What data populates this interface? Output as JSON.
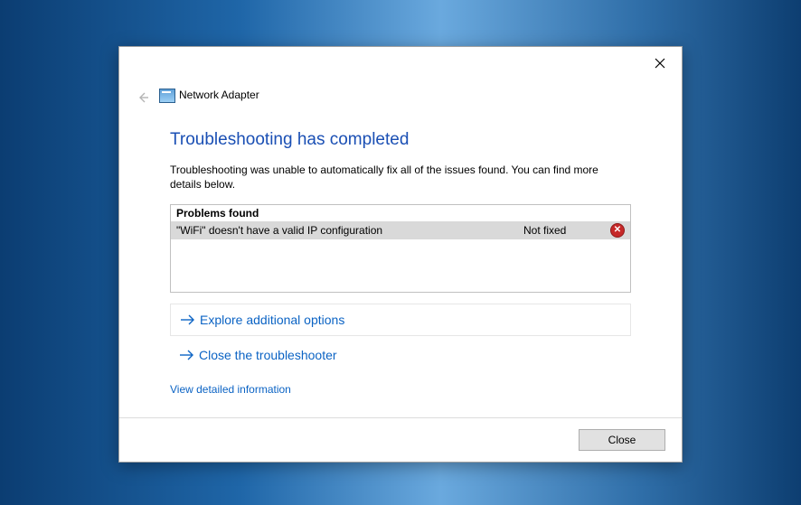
{
  "window": {
    "title": "Network Adapter"
  },
  "heading": "Troubleshooting has completed",
  "description": "Troubleshooting was unable to automatically fix all of the issues found. You can find more details below.",
  "problems": {
    "header": "Problems found",
    "row": {
      "description": "\"WiFi\" doesn't have a valid IP configuration",
      "status": "Not fixed"
    }
  },
  "actions": {
    "explore": "Explore additional options",
    "close_troubleshooter": "Close the troubleshooter"
  },
  "link_detailed": "View detailed information",
  "footer": {
    "close_button": "Close"
  }
}
